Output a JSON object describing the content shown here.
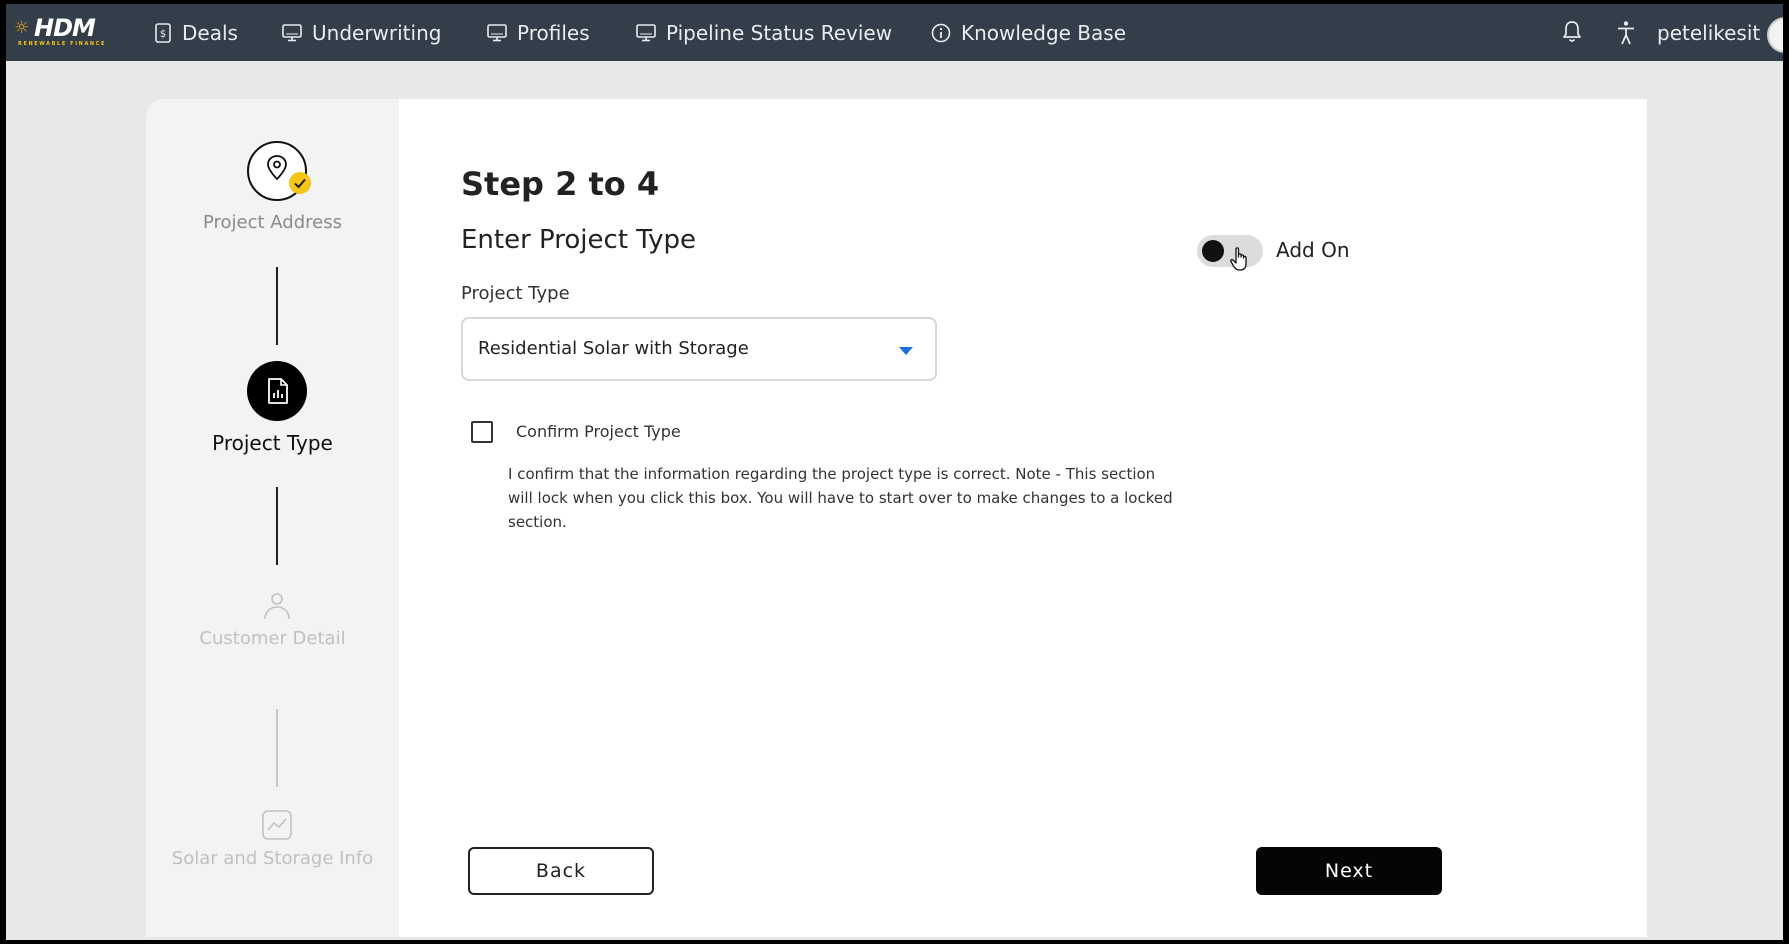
{
  "brand": {
    "name": "HDM",
    "tagline": "RENEWABLE FINANCE"
  },
  "nav": {
    "items": [
      {
        "label": "Deals",
        "icon": "dollar-doc-icon"
      },
      {
        "label": "Underwriting",
        "icon": "monitor-icon"
      },
      {
        "label": "Profiles",
        "icon": "monitor-icon"
      },
      {
        "label": "Pipeline Status Review",
        "icon": "monitor-icon"
      },
      {
        "label": "Knowledge Base",
        "icon": "info-icon"
      }
    ],
    "notifications_icon": "bell-icon",
    "accessibility_icon": "accessibility-icon",
    "username": "petelikesit"
  },
  "stepper": {
    "steps": [
      {
        "label": "Project Address",
        "icon": "map-pin-icon",
        "state": "completed"
      },
      {
        "label": "Project Type",
        "icon": "document-chart-icon",
        "state": "active"
      },
      {
        "label": "Customer Detail",
        "icon": "user-icon",
        "state": "pending"
      },
      {
        "label": "Solar and Storage Info",
        "icon": "chart-icon",
        "state": "pending"
      }
    ]
  },
  "form": {
    "step_title": "Step 2 to 4",
    "section_title": "Enter Project Type",
    "project_type_label": "Project Type",
    "project_type_value": "Residential Solar with Storage",
    "confirm_label": "Confirm Project Type",
    "confirm_checked": false,
    "confirm_note": "I confirm that the information regarding the project type is correct. Note - This section will lock when you click this box. You will have to start over to make changes to a locked section.",
    "add_on_label": "Add On",
    "add_on_enabled": false
  },
  "buttons": {
    "back": "Back",
    "next": "Next"
  },
  "colors": {
    "nav_bg": "#343d4a",
    "accent": "#1e6fd9",
    "check_badge": "#f5c518",
    "primary_button": "#050505"
  }
}
